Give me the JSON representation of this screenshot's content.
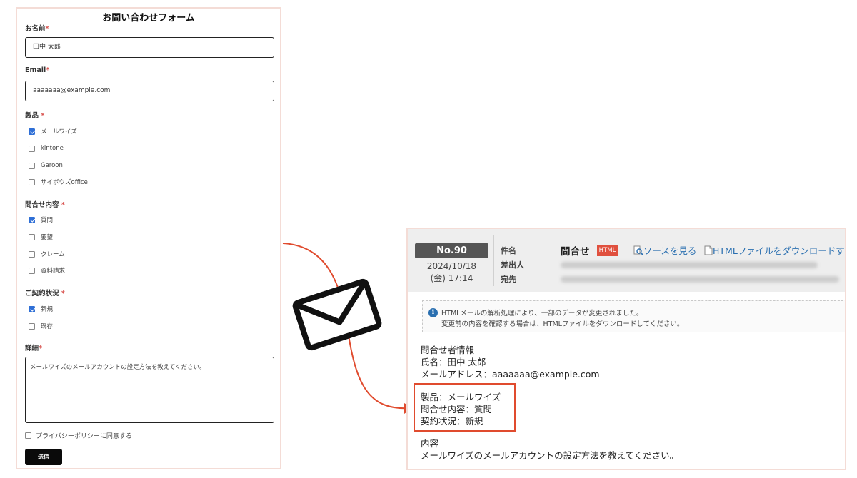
{
  "form": {
    "title": "お問い合わせフォーム",
    "name_label": "お名前",
    "name_value": "田中 太郎",
    "email_label": "Email",
    "email_value": "aaaaaaa@example.com",
    "required_mark": "*",
    "product_label": "製品",
    "products": [
      {
        "label": "メールワイズ",
        "checked": true
      },
      {
        "label": "kintone",
        "checked": false
      },
      {
        "label": "Garoon",
        "checked": false
      },
      {
        "label": "サイボウズoffice",
        "checked": false
      }
    ],
    "inquiry_label": "問合せ内容",
    "inquiries": [
      {
        "label": "質問",
        "checked": true
      },
      {
        "label": "要望",
        "checked": false
      },
      {
        "label": "クレーム",
        "checked": false
      },
      {
        "label": "資料請求",
        "checked": false
      }
    ],
    "contract_label": "ご契約状況",
    "contracts": [
      {
        "label": "新規",
        "checked": true
      },
      {
        "label": "既存",
        "checked": false
      }
    ],
    "detail_label": "詳細",
    "detail_value": "メールワイズのメールアカウントの設定方法を教えてください。",
    "privacy_label": "プライバシーポリシーに同意する",
    "submit_label": "送信"
  },
  "mail": {
    "number": "No.90",
    "date": "2024/10/18",
    "time": "(金) 17:14",
    "subject_label": "件名",
    "from_label": "差出人",
    "to_label": "宛先",
    "subject": "問合せ",
    "html_badge": "HTML",
    "view_source": "ソースを見る",
    "download_html": "HTMLファイルをダウンロードす",
    "notice_line1": "HTMLメールの解析処理により、一部のデータが変更されました。",
    "notice_line2": "変更前の内容を確認する場合は、HTMLファイルをダウンロードしてください。",
    "body": {
      "section_title": "問合せ者情報",
      "name_line": "氏名：田中 太郎",
      "email_line": "メールアドレス：aaaaaaa@example.com",
      "product_line": "製品：メールワイズ",
      "inquiry_line": "問合せ内容：質問",
      "contract_line": "契約状況：新規",
      "content_title": "内容",
      "content_text": "メールワイズのメールアカウントの設定方法を教えてください。"
    }
  },
  "colors": {
    "accent_red": "#e04b2e",
    "link_blue": "#2a6fb0",
    "checkbox_blue": "#2f6fd6",
    "panel_border": "#f4dcd6"
  },
  "icons": [
    "envelope-icon",
    "info-icon",
    "magnifier-icon",
    "file-icon",
    "arrow-connector"
  ]
}
